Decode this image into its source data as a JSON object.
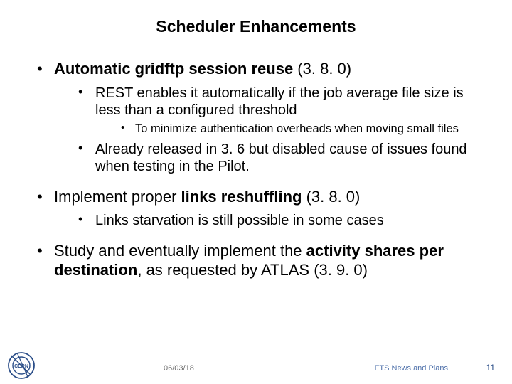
{
  "slide": {
    "title": "Scheduler Enhancements",
    "bullets": {
      "b1": {
        "prefix_bold": "Automatic gridftp session reuse",
        "suffix": " (3. 8. 0)",
        "sub": {
          "s1": "REST enables it automatically if the job average file size is less than a configured threshold",
          "s1a": "To minimize authentication overheads when moving small files",
          "s2": "Already released in 3. 6 but disabled cause of issues found when testing in the Pilot."
        }
      },
      "b2": {
        "pre": "Implement proper ",
        "bold": "links reshuffling",
        "post": " (3. 8. 0)",
        "sub": {
          "s1": "Links starvation is still possible in some cases"
        }
      },
      "b3": {
        "pre": "Study and eventually implement the ",
        "bold": "activity shares per destination",
        "post": ", as requested by ATLAS (3. 9. 0)"
      }
    }
  },
  "footer": {
    "date": "06/03/18",
    "title": "FTS News and Plans",
    "page": "11"
  },
  "logo": {
    "name": "cern-logo"
  }
}
